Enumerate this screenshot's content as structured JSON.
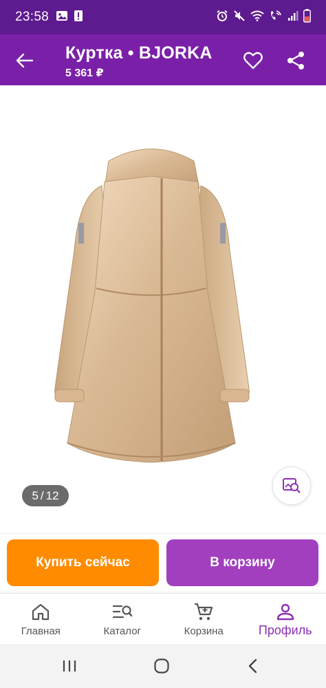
{
  "status_bar": {
    "time": "23:58",
    "left_icons": [
      "image-icon",
      "alert-icon"
    ],
    "right_icons": [
      "alarm-icon",
      "mute-icon",
      "wifi-icon",
      "wifi-call-icon",
      "signal-icon",
      "battery-icon"
    ]
  },
  "app_bar": {
    "title": "Куртка • BJORKA",
    "price": "5 361 ₽",
    "back_icon": "arrow-left-icon",
    "favorite_icon": "heart-icon",
    "share_icon": "share-icon"
  },
  "gallery": {
    "current": "5",
    "separator": "/",
    "total": "12",
    "image_icon": "jacket-image",
    "visual_search_icon": "image-search-icon"
  },
  "actions": {
    "buy_now_label": "Купить сейчас",
    "add_to_cart_label": "В корзину"
  },
  "bottom_nav": {
    "items": [
      {
        "label": "Главная",
        "icon": "home-icon"
      },
      {
        "label": "Каталог",
        "icon": "catalog-search-icon"
      },
      {
        "label": "Корзина",
        "icon": "cart-icon"
      },
      {
        "label": "Профиль",
        "icon": "profile-icon"
      }
    ],
    "active_index": 3
  },
  "colors": {
    "status_bar": "#5e1a8f",
    "app_bar": "#7a1fa8",
    "buy_now": "#ff8c00",
    "add_to_cart": "#a23fbf",
    "nav_active": "#8d2fb5"
  }
}
